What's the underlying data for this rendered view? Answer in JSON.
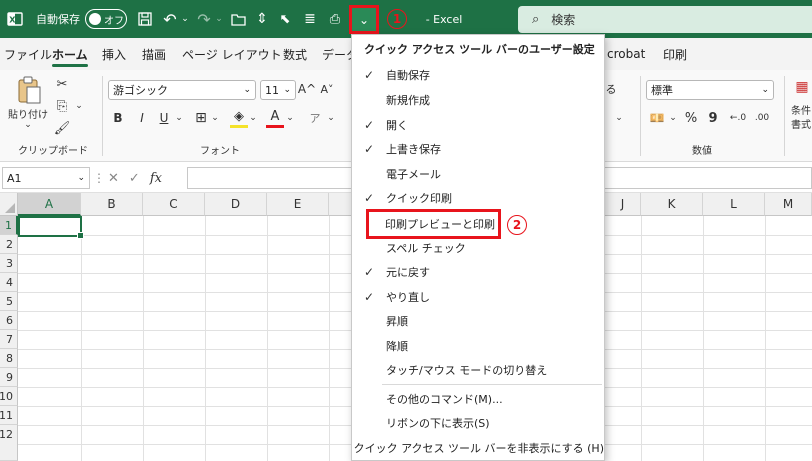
{
  "titlebar": {
    "autosave_label": "自動保存",
    "autosave_state": "オフ",
    "file_name_partial": "- Excel",
    "search_placeholder": "検索",
    "qat_dropdown_glyph": "⌄",
    "callout_1": "1",
    "callout_2": "2"
  },
  "tabs": [
    "ファイル",
    "ホーム",
    "挿入",
    "描画",
    "ページ レイアウト",
    "数式",
    "データ",
    "crobat",
    "印刷"
  ],
  "active_tab": "ホーム",
  "ribbon": {
    "clipboard_paste": "貼り付け",
    "clipboard_group": "クリップボード",
    "font_name": "游ゴシック",
    "font_size": "11",
    "font_group": "フォント",
    "bold": "B",
    "italic": "I",
    "underline": "U",
    "grow_font": "A^",
    "shrink_font": "A˅",
    "number_format": "標準",
    "number_group": "数値",
    "percent": "%",
    "comma": "9",
    "cond_format_line1": "条件",
    "cond_format_line2": "書式",
    "partial_label": "る"
  },
  "formula_bar": {
    "name_box": "A1",
    "fx": "fx"
  },
  "grid": {
    "columns": [
      "A",
      "B",
      "C",
      "D",
      "E",
      "J",
      "K",
      "L",
      "M"
    ],
    "rows": [
      "1",
      "2",
      "3",
      "4",
      "5",
      "6",
      "7",
      "8",
      "9",
      "10",
      "11",
      "12"
    ]
  },
  "menu": {
    "title": "クイック アクセス ツール バーのユーザー設定",
    "items": [
      {
        "label": "自動保存",
        "checked": "✓"
      },
      {
        "label": "新規作成",
        "checked": ""
      },
      {
        "label": "開く",
        "checked": "✓"
      },
      {
        "label": "上書き保存",
        "checked": "✓"
      },
      {
        "label": "電子メール",
        "checked": ""
      },
      {
        "label": "クイック印刷",
        "checked": "✓"
      },
      {
        "label": "印刷プレビューと印刷",
        "checked": ""
      },
      {
        "label": "スペル チェック",
        "checked": ""
      },
      {
        "label": "元に戻す",
        "checked": "✓"
      },
      {
        "label": "やり直し",
        "checked": "✓"
      },
      {
        "label": "昇順",
        "checked": ""
      },
      {
        "label": "降順",
        "checked": ""
      },
      {
        "label": "タッチ/マウス モードの切り替え",
        "checked": ""
      }
    ],
    "more_commands": "その他のコマンド(M)...",
    "show_below_ribbon": "リボンの下に表示(S)",
    "hide_qat": "クイック アクセス ツール バーを非表示にする (H)"
  },
  "colors": {
    "accent": "#1e7145",
    "highlight": "#e8141c"
  }
}
